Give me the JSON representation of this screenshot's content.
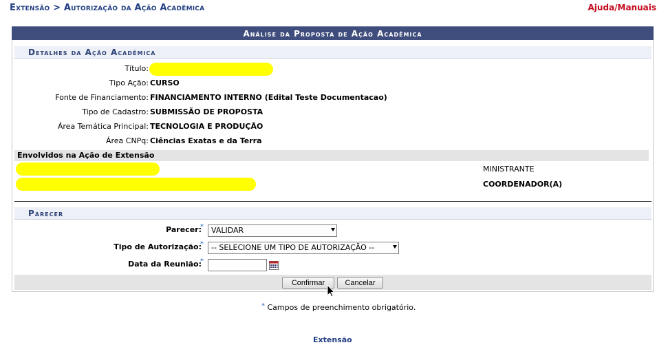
{
  "breadcrumb": "Extensão > Autorização da Ação Acadêmica",
  "help_link": "Ajuda/Manuais",
  "caption": "Análise da Proposta de Ação Acadêmica",
  "details": {
    "section_title": "Detalhes da Ação Acadêmica",
    "fields": [
      {
        "label": "Título:",
        "value": ""
      },
      {
        "label": "Tipo Ação:",
        "value": "CURSO"
      },
      {
        "label": "Fonte de Financiamento:",
        "value": "FINANCIAMENTO INTERNO (Edital Teste Documentacao)"
      },
      {
        "label": "Tipo de Cadastro:",
        "value": "SUBMISSÃO DE PROPOSTA"
      },
      {
        "label": "Área Temática Principal:",
        "value": "TECNOLOGIA E PRODUÇÃO"
      },
      {
        "label": "Área CNPq:",
        "value": "Ciências Exatas e da Terra"
      }
    ]
  },
  "envolvidos": {
    "title": "Envolvidos na Ação de Extensão",
    "rows": [
      {
        "name": "",
        "role": "MINISTRANTE"
      },
      {
        "name": "",
        "role": "COORDENADOR(A)"
      }
    ]
  },
  "parecer": {
    "section_title": "Parecer",
    "parecer_label": "Parecer:",
    "parecer_value": "VALIDAR",
    "tipo_label": "Tipo de Autorização:",
    "tipo_value": "-- SELECIONE UM TIPO DE AUTORIZAÇÃO --",
    "data_label": "Data da Reunião:",
    "data_value": "",
    "required_star": "*"
  },
  "buttons": {
    "confirm": "Confirmar",
    "cancel": "Cancelar"
  },
  "note": "Campos de preenchimento obrigatório.",
  "footer_link": "Extensão",
  "colors": {
    "caption_bg": "#3f4d7c",
    "breadcrumb": "#223f83",
    "help": "#c4091d",
    "redaction": "#ffff00"
  }
}
